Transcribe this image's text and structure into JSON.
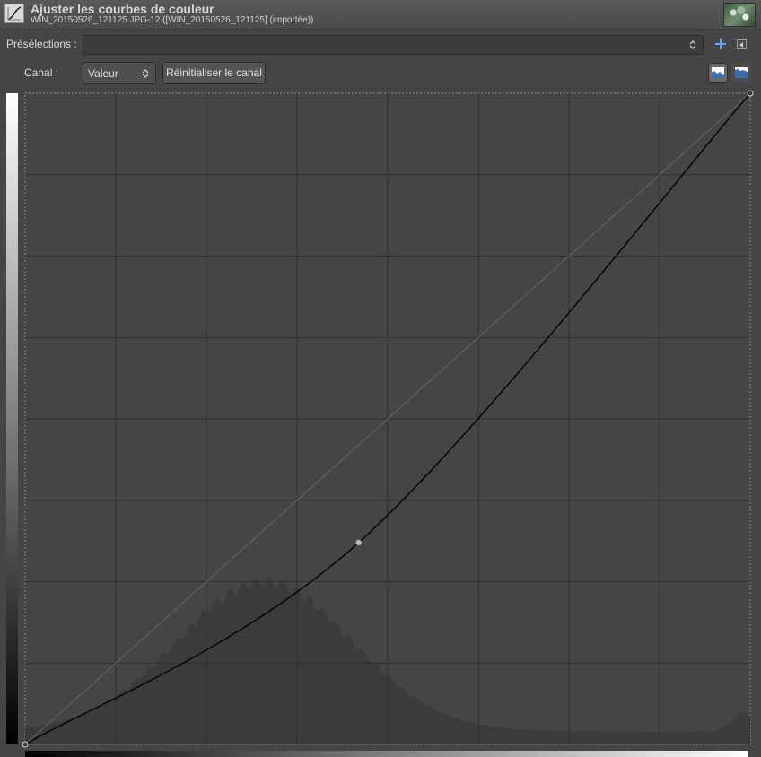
{
  "dialog": {
    "title": "Ajuster les courbes de couleur",
    "subtitle": "WIN_20150526_121125.JPG-12 ([WIN_20150526_121125] (importée))",
    "tool_icon": "curves-tool-icon",
    "thumbnail": "image-thumbnail"
  },
  "presets": {
    "label": "Présélections :",
    "value": "",
    "add_icon": "plus-icon",
    "menu_icon": "tab-menu-icon"
  },
  "channel": {
    "label": "Canal :",
    "value": "Valeur",
    "reset_label": "Réinitialiser le canal",
    "linear_histogram_icon": "linear-histogram-icon",
    "log_histogram_icon": "logarithmic-histogram-icon"
  },
  "curve": {
    "channel": "Valeur",
    "points": [
      [
        0,
        0
      ],
      [
        0.46,
        0.31
      ],
      [
        1,
        1
      ]
    ],
    "grid_divisions": 8
  },
  "colors": {
    "accent": "#5fa6ff",
    "curve": "#000000",
    "histogram": "#3b3b3b",
    "grid": "#2f2f2f",
    "panel": "#454545"
  }
}
